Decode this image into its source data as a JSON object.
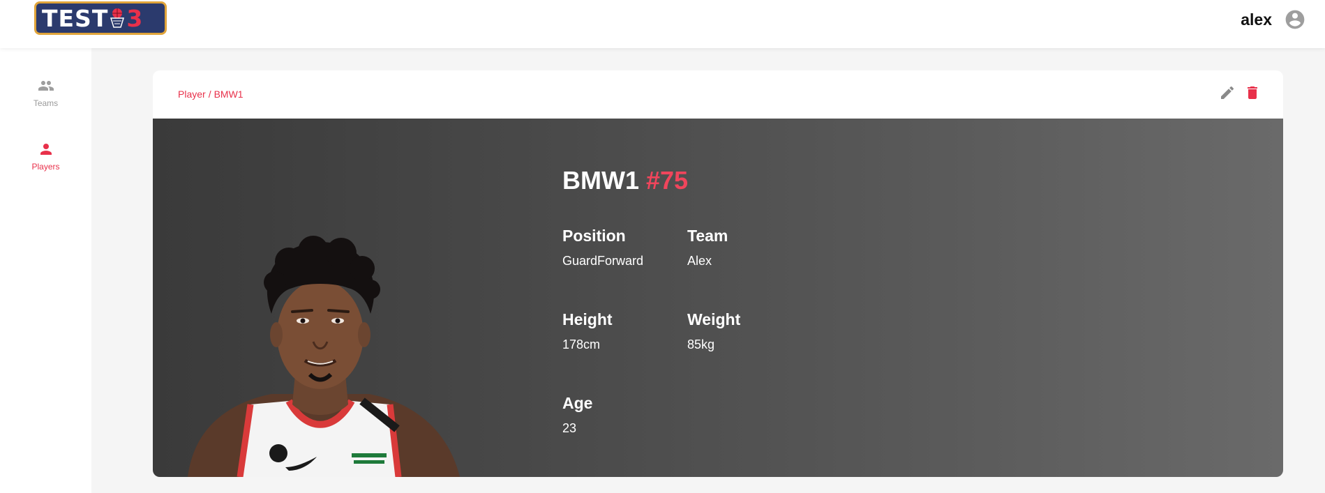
{
  "app": {
    "logo_text": "TEST",
    "logo_number": "3",
    "accent_color": "#e8304a"
  },
  "header": {
    "username": "alex",
    "avatar_icon": "account-circle-icon"
  },
  "sidebar": {
    "items": [
      {
        "label": "Teams",
        "icon": "people-icon",
        "active": false
      },
      {
        "label": "Players",
        "icon": "person-icon",
        "active": true
      }
    ]
  },
  "breadcrumb": {
    "parent": "Player",
    "separator": "/",
    "current": "BMW1"
  },
  "actions": {
    "edit_icon": "pencil-icon",
    "delete_icon": "trash-icon"
  },
  "player": {
    "name": "BMW1",
    "number": "#75",
    "stats": {
      "position": {
        "label": "Position",
        "value": "GuardForward"
      },
      "team": {
        "label": "Team",
        "value": "Alex"
      },
      "height": {
        "label": "Height",
        "value": "178cm"
      },
      "weight": {
        "label": "Weight",
        "value": "85kg"
      },
      "age": {
        "label": "Age",
        "value": "23"
      }
    }
  }
}
